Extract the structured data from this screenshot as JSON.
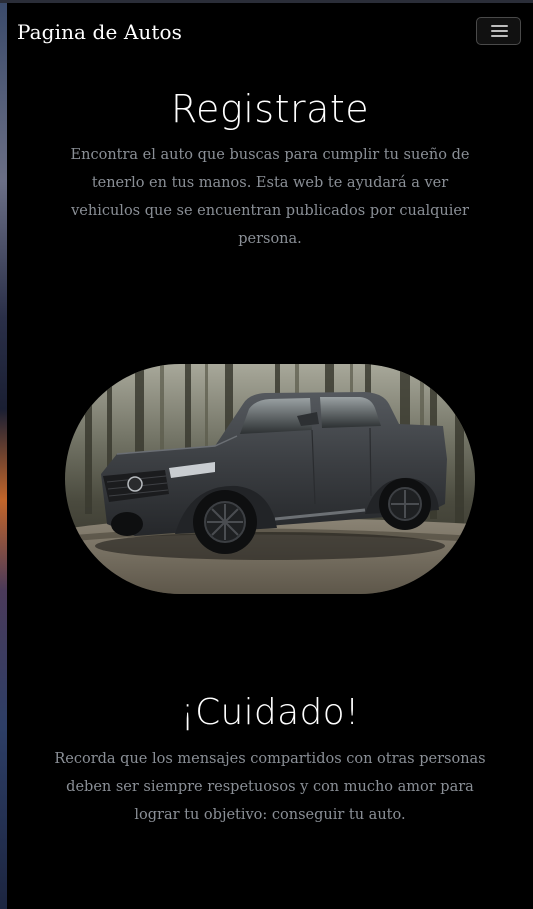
{
  "navbar": {
    "brand": "Pagina de Autos",
    "toggle_icon": "hamburger-menu-icon"
  },
  "section1": {
    "title": "Registrate",
    "text": "Encontra el auto que buscas para cumplir tu sueño de tenerlo en tus manos. Esta web te ayudará a ver vehiculos que se encuentran publicados por cualquier persona."
  },
  "hero_image": {
    "subject": "dark grey pickup truck on a forest dirt road"
  },
  "section2": {
    "title": "¡Cuidado!",
    "text": "Recorda que los mensajes compartidos con otras personas deben ser siempre respetuosos y con mucho amor para lograr tu objetivo: conseguir tu auto."
  },
  "colors": {
    "background": "#000000",
    "title": "#ffffff",
    "body_text": "#8a8f96",
    "truck": "#3b3e42"
  }
}
